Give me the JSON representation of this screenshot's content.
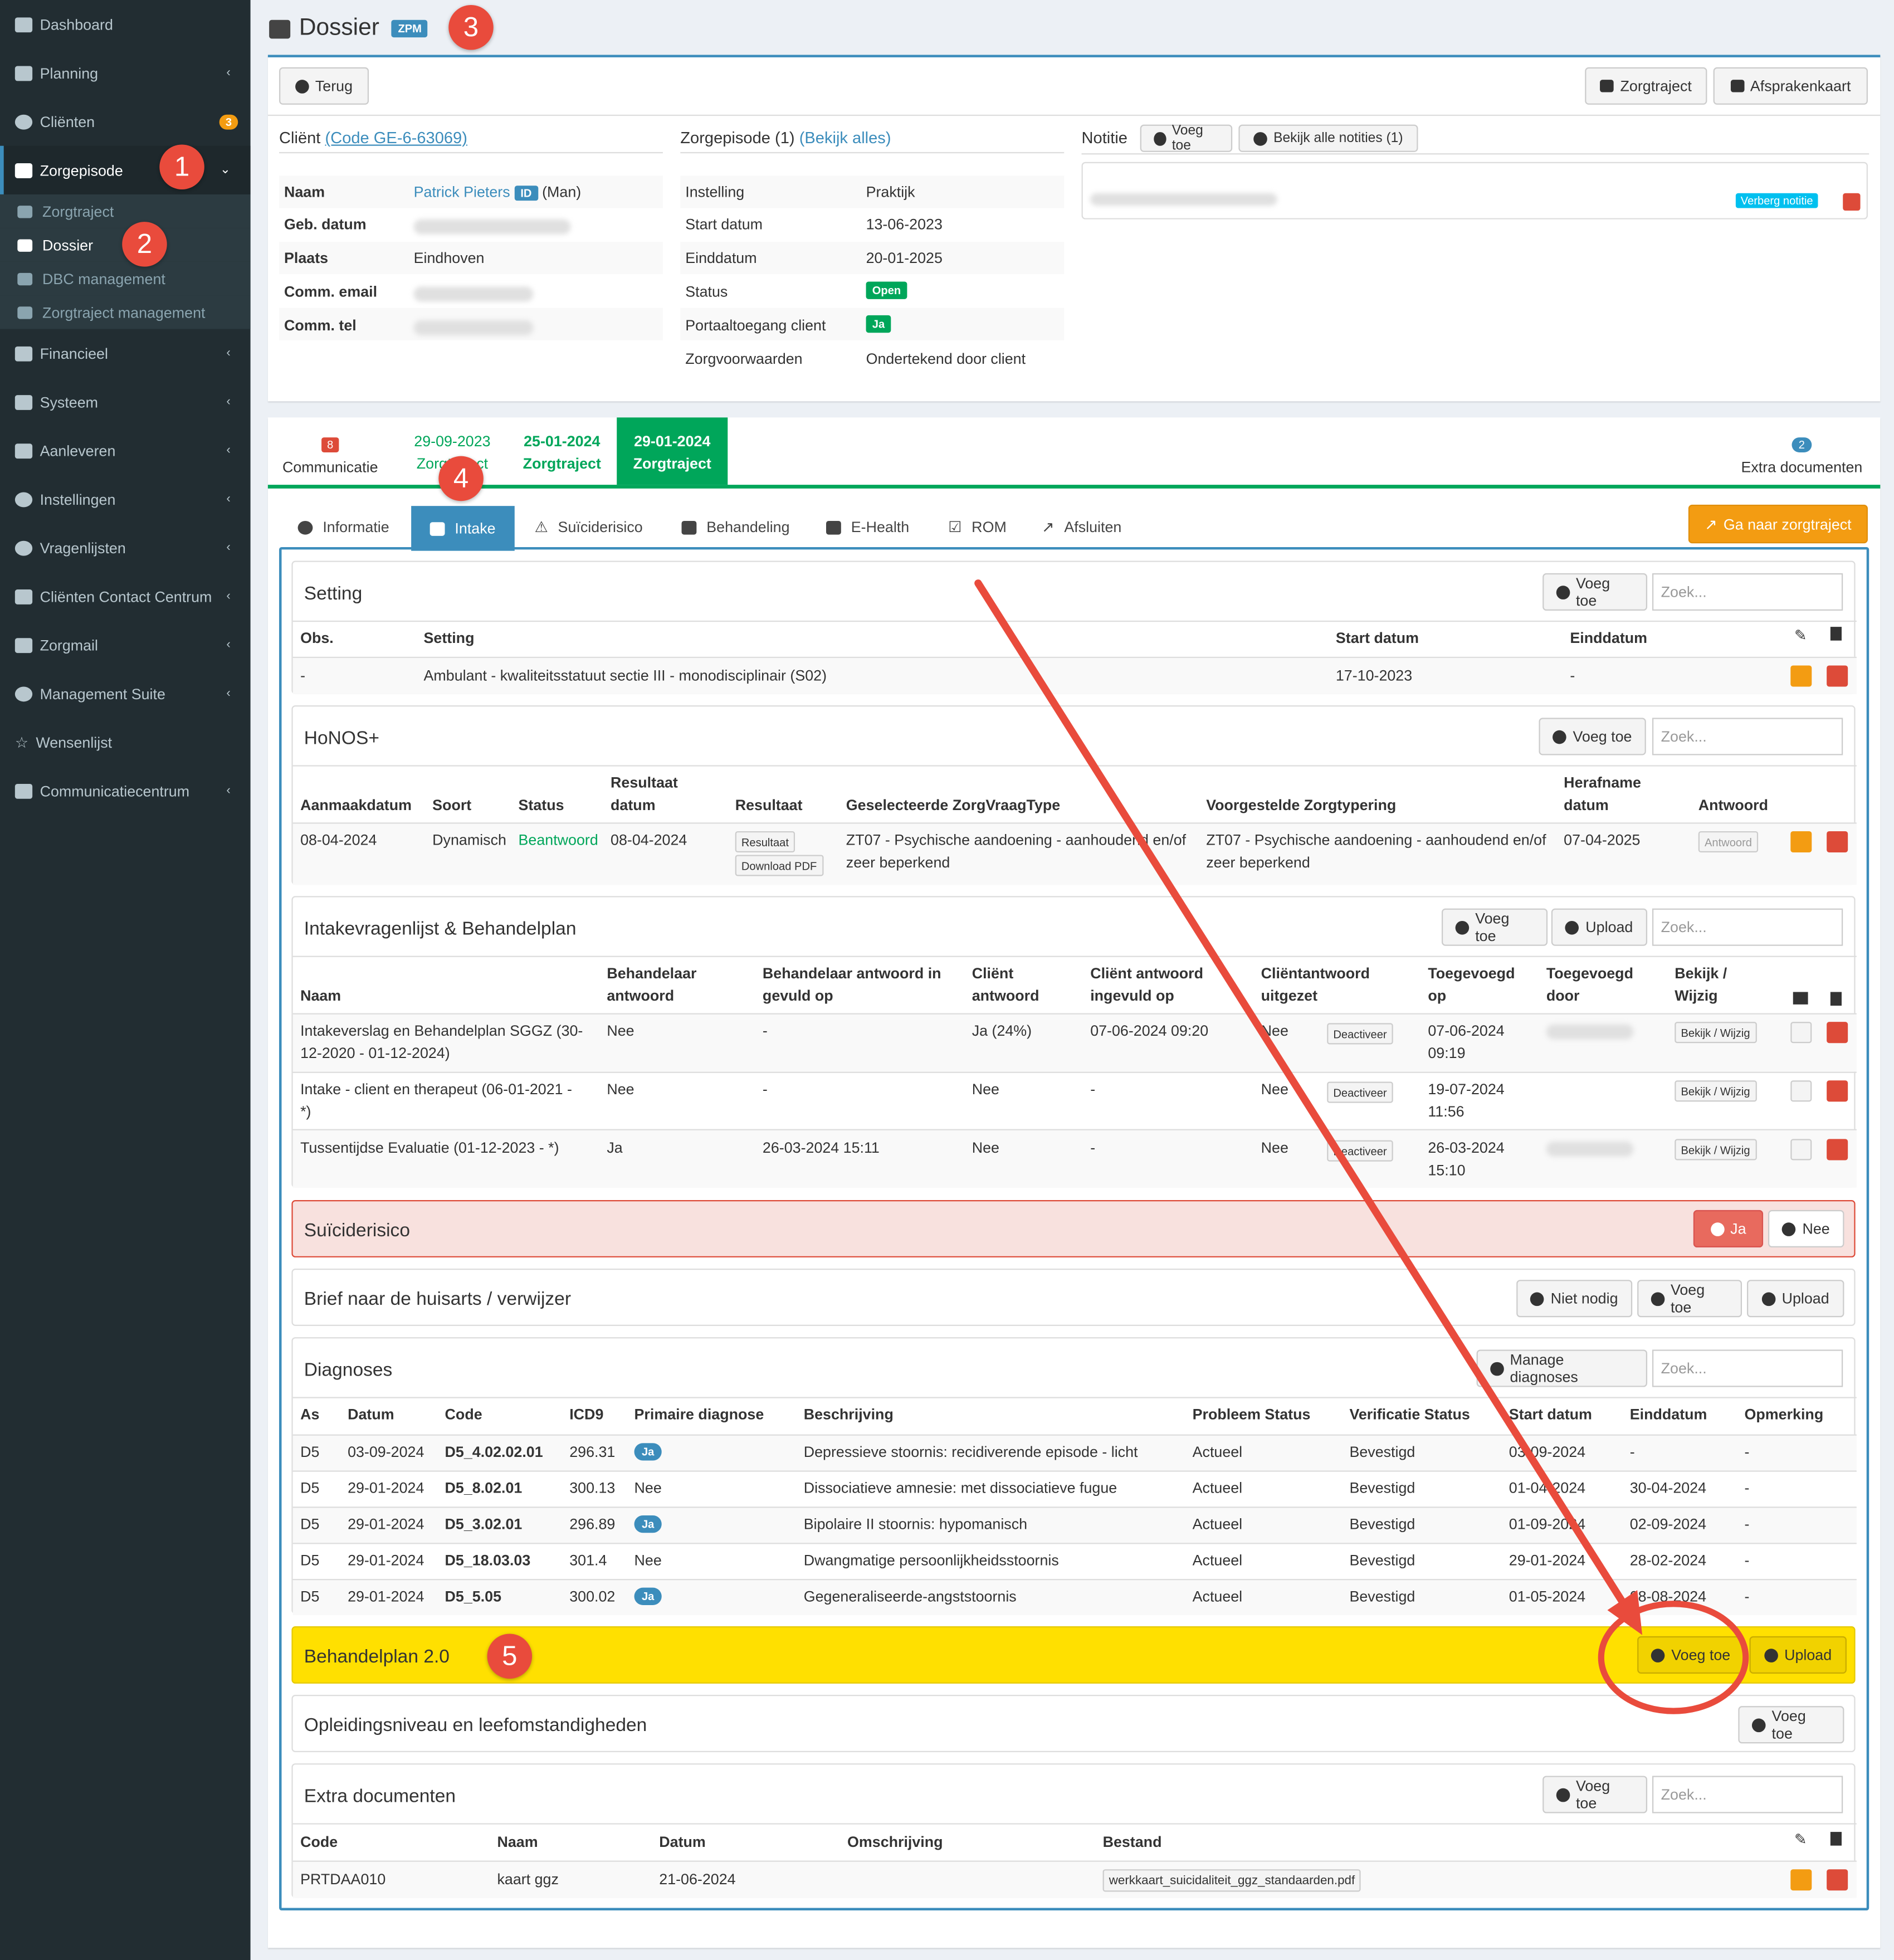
{
  "sidebar": {
    "items": [
      {
        "label": "Dashboard",
        "icon": "dashboard-icon"
      },
      {
        "label": "Planning",
        "icon": "calendar-icon"
      },
      {
        "label": "Cliënten",
        "icon": "user-icon",
        "badge": "3"
      },
      {
        "label": "Zorgepisode",
        "icon": "medkit-icon"
      },
      {
        "label": "Financieel",
        "icon": "book-icon"
      },
      {
        "label": "Systeem",
        "icon": "cogs-icon"
      },
      {
        "label": "Aanleveren",
        "icon": "truck-icon"
      },
      {
        "label": "Instellingen",
        "icon": "gear-icon"
      },
      {
        "label": "Vragenlijsten",
        "icon": "globe-icon"
      },
      {
        "label": "Cliënten Contact Centrum",
        "icon": "envelope-icon"
      },
      {
        "label": "Zorgmail",
        "icon": "envelope-icon"
      },
      {
        "label": "Management Suite",
        "icon": "globe-icon"
      },
      {
        "label": "Wensenlijst",
        "icon": "star-icon"
      },
      {
        "label": "Communicatiecentrum",
        "icon": "envelope-icon"
      }
    ],
    "sub": [
      {
        "label": "Zorgtraject"
      },
      {
        "label": "Dossier"
      },
      {
        "label": "DBC management"
      },
      {
        "label": "Zorgtraject management"
      }
    ]
  },
  "markers": [
    "1",
    "2",
    "3",
    "4",
    "5"
  ],
  "header": {
    "title": "Dossier",
    "badge": "ZPM"
  },
  "top": {
    "back": "Terug",
    "zorgtraject": "Zorgtraject",
    "afspraken": "Afsprakenkaart"
  },
  "client": {
    "title": "Cliënt",
    "code": "(Code GE-6-63069)",
    "rows": [
      {
        "k": "Naam",
        "v": "Patrick Pieters"
      },
      {
        "k": "Geb. datum",
        "v": ""
      },
      {
        "k": "Plaats",
        "v": "Eindhoven"
      },
      {
        "k": "Comm. email",
        "v": ""
      },
      {
        "k": "Comm. tel",
        "v": ""
      }
    ],
    "id_badge": "ID",
    "gender": "(Man)"
  },
  "episode": {
    "title": "Zorgepisode (1)",
    "link": "(Bekijk alles)",
    "rows": [
      {
        "k": "Instelling",
        "v": "Praktijk"
      },
      {
        "k": "Start datum",
        "v": "13-06-2023"
      },
      {
        "k": "Einddatum",
        "v": "20-01-2025"
      },
      {
        "k": "Status",
        "v": "Open"
      },
      {
        "k": "Portaaltoegang client",
        "v": "Ja"
      },
      {
        "k": "Zorgvoorwaarden",
        "v": "Ondertekend door client"
      }
    ]
  },
  "notes": {
    "title": "Notitie",
    "add": "Voeg toe",
    "all": "Bekijk alle notities (1)",
    "hide": "Verberg notitie"
  },
  "tabs": [
    {
      "top": "8",
      "label": "Communicatie"
    },
    {
      "top": "29-09-2023",
      "label": "Zorgtraject"
    },
    {
      "top": "25-01-2024",
      "label": "Zorgtraject"
    },
    {
      "top": "29-01-2024",
      "label": "Zorgtraject"
    },
    {
      "top": "2",
      "label": "Extra documenten"
    }
  ],
  "subtabs": [
    "Informatie",
    "Intake",
    "Suïciderisico",
    "Behandeling",
    "E-Health",
    "ROM",
    "Afsluiten"
  ],
  "goto": "Ga naar zorgtraject",
  "common": {
    "add": "Voeg toe",
    "search": "Zoek...",
    "upload": "Upload",
    "manage": "Manage diagnoses",
    "not_needed": "Niet nodig",
    "ja": "Ja",
    "nee": "Nee"
  },
  "setting": {
    "title": "Setting",
    "headers": [
      "Obs.",
      "Setting",
      "Start datum",
      "Einddatum"
    ],
    "row": [
      "-",
      "Ambulant - kwaliteitsstatuut sectie III - monodisciplinair (S02)",
      "17-10-2023",
      "-"
    ]
  },
  "honos": {
    "title": "HoNOS+",
    "headers": [
      "Aanmaakdatum",
      "Soort",
      "Status",
      "Resultaat datum",
      "Resultaat",
      "Geselecteerde ZorgVraagType",
      "Voorgestelde Zorgtypering",
      "Herafname datum",
      "Antwoord"
    ],
    "row": [
      "08-04-2024",
      "Dynamisch",
      "Beantwoord",
      "08-04-2024",
      "ZT07 - Psychische aandoening - aanhoudend en/of zeer beperkend",
      "ZT07 - Psychische aandoening - aanhoudend en/of zeer beperkend",
      "07-04-2025"
    ],
    "resultaat": "Resultaat",
    "download": "Download PDF",
    "antwoord": "Antwoord"
  },
  "intake": {
    "title": "Intakevragenlijst & Behandelplan",
    "headers": [
      "Naam",
      "Behandelaar antwoord",
      "Behandelaar antwoord in gevuld op",
      "Cliënt antwoord",
      "Cliënt antwoord ingevuld op",
      "Cliëntantwoord uitgezet",
      "Toegevoegd op",
      "Toegevoegd door",
      "Bekijk / Wijzig"
    ],
    "rows": [
      {
        "naam": "Intakeverslag en Behandelplan SGGZ (30-12-2020 - 01-12-2024)",
        "beh": "Nee",
        "behop": "-",
        "cli": "Ja (24%)",
        "cliop": "07-06-2024 09:20",
        "uit": "Nee",
        "toe": "07-06-2024 09:19"
      },
      {
        "naam": "Intake - client en therapeut (06-01-2021 - *)",
        "beh": "Nee",
        "behop": "-",
        "cli": "Nee",
        "cliop": "-",
        "uit": "Nee",
        "toe": "19-07-2024 11:56"
      },
      {
        "naam": "Tussentijdse Evaluatie (01-12-2023 - *)",
        "beh": "Ja",
        "behop": "26-03-2024 15:11",
        "cli": "Nee",
        "cliop": "-",
        "uit": "Nee",
        "toe": "26-03-2024 15:10"
      }
    ],
    "deactiveer": "Deactiveer",
    "bekijk": "Bekijk / Wijzig"
  },
  "suicide": {
    "title": "Suïciderisico"
  },
  "brief": {
    "title": "Brief naar de huisarts / verwijzer"
  },
  "diagnoses": {
    "title": "Diagnoses",
    "headers": [
      "As",
      "Datum",
      "Code",
      "ICD9",
      "Primaire diagnose",
      "Beschrijving",
      "Probleem Status",
      "Verificatie Status",
      "Start datum",
      "Einddatum",
      "Opmerking"
    ],
    "rows": [
      [
        "D5",
        "03-09-2024",
        "D5_4.02.02.01",
        "296.31",
        "Ja",
        "Depressieve stoornis: recidiverende episode - licht",
        "Actueel",
        "Bevestigd",
        "03-09-2024",
        "-",
        "-"
      ],
      [
        "D5",
        "29-01-2024",
        "D5_8.02.01",
        "300.13",
        "Nee",
        "Dissociatieve amnesie: met dissociatieve fugue",
        "Actueel",
        "Bevestigd",
        "01-04-2024",
        "30-04-2024",
        "-"
      ],
      [
        "D5",
        "29-01-2024",
        "D5_3.02.01",
        "296.89",
        "Ja",
        "Bipolaire II stoornis: hypomanisch",
        "Actueel",
        "Bevestigd",
        "01-09-2024",
        "02-09-2024",
        "-"
      ],
      [
        "D5",
        "29-01-2024",
        "D5_18.03.03",
        "301.4",
        "Nee",
        "Dwangmatige persoonlijkheidsstoornis",
        "Actueel",
        "Bevestigd",
        "29-01-2024",
        "28-02-2024",
        "-"
      ],
      [
        "D5",
        "29-01-2024",
        "D5_5.05",
        "300.02",
        "Ja",
        "Gegeneraliseerde-angststoornis",
        "Actueel",
        "Bevestigd",
        "01-05-2024",
        "08-08-2024",
        "-"
      ]
    ]
  },
  "behandelplan": {
    "title": "Behandelplan 2.0"
  },
  "opleiding": {
    "title": "Opleidingsniveau en leefomstandigheden"
  },
  "extra": {
    "title": "Extra documenten",
    "headers": [
      "Code",
      "Naam",
      "Datum",
      "Omschrijving",
      "Bestand"
    ],
    "row": [
      "PRTDAA010",
      "kaart ggz",
      "21-06-2024",
      "",
      "werkkaart_suicidaliteit_ggz_standaarden.pdf"
    ]
  },
  "colors": {
    "sidebar": "#222d32",
    "primary": "#3c8dbc",
    "green": "#00a65a",
    "orange": "#f39c12",
    "red": "#dd4b39",
    "annotation": "#e94b3c",
    "highlight": "#ffe000"
  }
}
